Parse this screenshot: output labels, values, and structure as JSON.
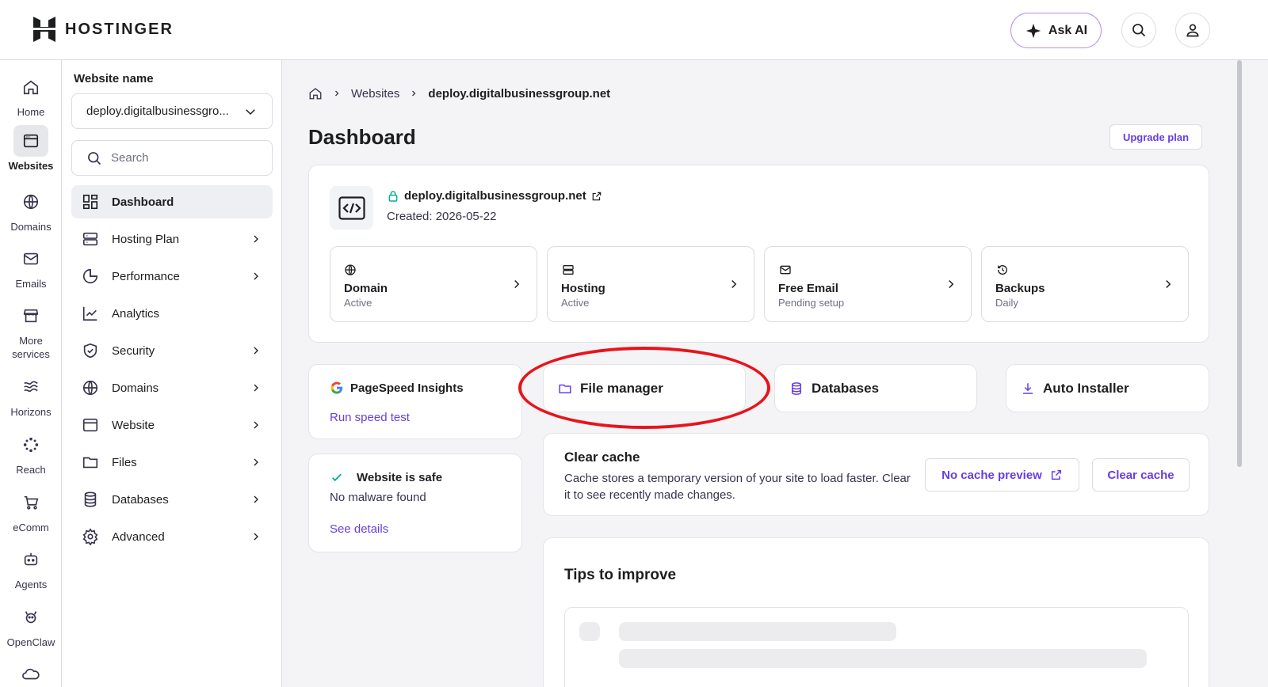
{
  "app": {
    "logo_text": "HOSTINGER",
    "ask_ai_label": "Ask AI",
    "accent_color": "#673de6"
  },
  "rail": [
    {
      "label": "Home",
      "icon": "home-icon"
    },
    {
      "label": "Websites",
      "icon": "websites-icon",
      "active": true
    },
    {
      "label": "Domains",
      "icon": "globe-icon"
    },
    {
      "label": "Emails",
      "icon": "mail-icon"
    },
    {
      "label": "More services",
      "icon": "store-icon"
    },
    {
      "label": "Horizons",
      "icon": "horizons-icon"
    },
    {
      "label": "Reach",
      "icon": "reach-icon"
    },
    {
      "label": "eComm",
      "icon": "cart-icon"
    },
    {
      "label": "Agents",
      "icon": "agent-icon"
    },
    {
      "label": "OpenClaw",
      "icon": "openclaw-icon"
    }
  ],
  "sidebar": {
    "website_label": "Website name",
    "selected_site": "deploy.digitalbusinessgro...",
    "search_placeholder": "Search",
    "items": [
      {
        "label": "Dashboard",
        "active": true
      },
      {
        "label": "Hosting Plan"
      },
      {
        "label": "Performance"
      },
      {
        "label": "Analytics"
      },
      {
        "label": "Security"
      },
      {
        "label": "Domains"
      },
      {
        "label": "Website"
      },
      {
        "label": "Files"
      },
      {
        "label": "Databases"
      },
      {
        "label": "Advanced"
      }
    ]
  },
  "main": {
    "breadcrumb": [
      "Websites",
      "deploy.digitalbusinessgroup.net"
    ],
    "title": "Dashboard",
    "upgrade_label": "Upgrade plan",
    "site": {
      "domain": "deploy.digitalbusinessgroup.net",
      "created": "Created: 2026-05-22"
    },
    "status_cards": [
      {
        "title": "Domain",
        "status": "Active"
      },
      {
        "title": "Hosting",
        "status": "Active"
      },
      {
        "title": "Free Email",
        "status": "Pending setup"
      },
      {
        "title": "Backups",
        "status": "Daily"
      }
    ],
    "pagespeed": {
      "title": "PageSpeed Insights",
      "link": "Run speed test"
    },
    "quick_links": {
      "file_manager": "File manager",
      "databases": "Databases",
      "auto_installer": "Auto Installer"
    },
    "security": {
      "title": "Website is safe",
      "subtitle": "No malware found",
      "link": "See details"
    },
    "cache": {
      "title": "Clear cache",
      "description": "Cache stores a temporary version of your site to load faster. Clear it to see recently made changes.",
      "preview_label": "No cache preview",
      "clear_label": "Clear cache"
    },
    "tips": {
      "title": "Tips to improve"
    }
  }
}
